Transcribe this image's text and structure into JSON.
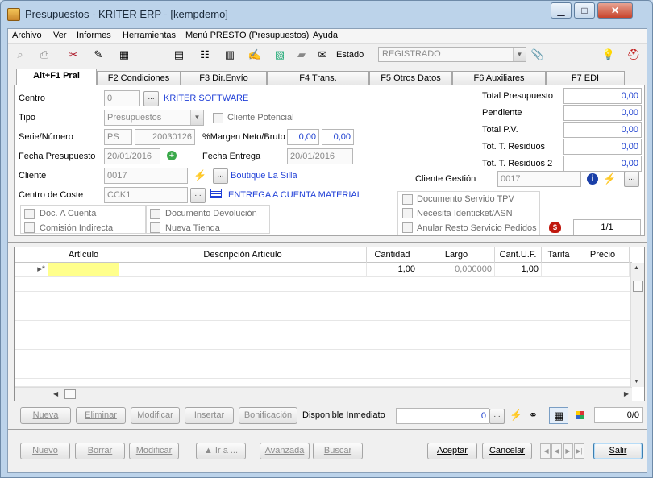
{
  "window": {
    "title": "Presupuestos - KRITER ERP - [kempdemo]",
    "minimize": "▁",
    "maximize": "□",
    "close": "✕"
  },
  "menu": [
    "Archivo",
    "Ver",
    "Informes",
    "Herramientas",
    "Menú PRESTO (Presupuestos)",
    "Ayuda"
  ],
  "toolbar": {
    "estado_label": "Estado",
    "estado_value": "REGISTRADO",
    "icons": [
      "preview-icon",
      "print-icon",
      "tools-icon",
      "edit-document-icon",
      "calculator-icon",
      "grid-icon",
      "tree-icon",
      "table-icon",
      "notes-icon",
      "chart-icon",
      "comment-icon",
      "envelope-icon",
      "paperclip-icon",
      "lightbulb-icon",
      "help-icon"
    ]
  },
  "tabs": [
    "Alt+F1 Pral",
    "F2 Condiciones",
    "F3 Dir.Envío",
    "F4 Trans.",
    "F5 Otros Datos",
    "F6 Auxiliares",
    "F7 EDI"
  ],
  "form": {
    "centro_label": "Centro",
    "centro_value": "0",
    "centro_name": "KRITER SOFTWARE",
    "tipo_label": "Tipo",
    "tipo_value": "Presupuestos",
    "cliente_potencial": "Cliente Potencial",
    "serie_label": "Serie/Número",
    "serie_value": "PS",
    "numero_value": "20030126",
    "margen_label": "%Margen Neto/Bruto",
    "margen_neto": "0,00",
    "margen_bruto": "0,00",
    "fecha_presupuesto_label": "Fecha Presupuesto",
    "fecha_presupuesto": "20/01/2016",
    "fecha_entrega_label": "Fecha Entrega",
    "fecha_entrega": "20/01/2016",
    "cliente_label": "Cliente",
    "cliente_value": "0017",
    "cliente_name": "Boutique La Silla",
    "centro_coste_label": "Centro de Coste",
    "centro_coste_value": "CCK1",
    "centro_coste_name": "ENTREGA A CUENTA MATERIAL",
    "cliente_gestion_label": "Cliente Gestión",
    "cliente_gestion_value": "0017",
    "counter": "1/1",
    "checks_left": [
      "Doc. A Cuenta",
      "Comisión Indirecta"
    ],
    "checks_mid": [
      "Documento Devolución",
      "Nueva Tienda"
    ],
    "checks_right": [
      "Documento Servido TPV",
      "Necesita Identicket/ASN",
      "Anular Resto Servicio Pedidos"
    ],
    "totals": [
      {
        "label": "Total Presupuesto",
        "value": "0,00"
      },
      {
        "label": "Pendiente",
        "value": "0,00"
      },
      {
        "label": "Total P.V.",
        "value": "0,00"
      },
      {
        "label": "Tot. T. Residuos",
        "value": "0,00"
      },
      {
        "label": "Tot. T. Residuos 2",
        "value": "0,00"
      }
    ]
  },
  "grid": {
    "columns": [
      "Artículo",
      "Descripción Artículo",
      "Cantidad",
      "Largo",
      "Cant.U.F.",
      "Tarifa",
      "Precio"
    ],
    "row": {
      "cantidad": "1,00",
      "largo": "0,000000",
      "cant_uf": "1,00"
    }
  },
  "line_buttons": {
    "nueva": "Nueva",
    "eliminar": "Eliminar",
    "modificar": "Modificar",
    "insertar": "Insertar",
    "bonificacion": "Bonificación",
    "disponible_label": "Disponible Inmediato",
    "disponible_value": "0",
    "page": "0/0"
  },
  "bottom_buttons": {
    "nuevo": "Nuevo",
    "borrar": "Borrar",
    "modificar": "Modificar",
    "ir_a": "▲ Ir a ...",
    "avanzada": "Avanzada",
    "buscar": "Buscar",
    "aceptar": "Aceptar",
    "cancelar": "Cancelar",
    "salir": "Salir"
  }
}
